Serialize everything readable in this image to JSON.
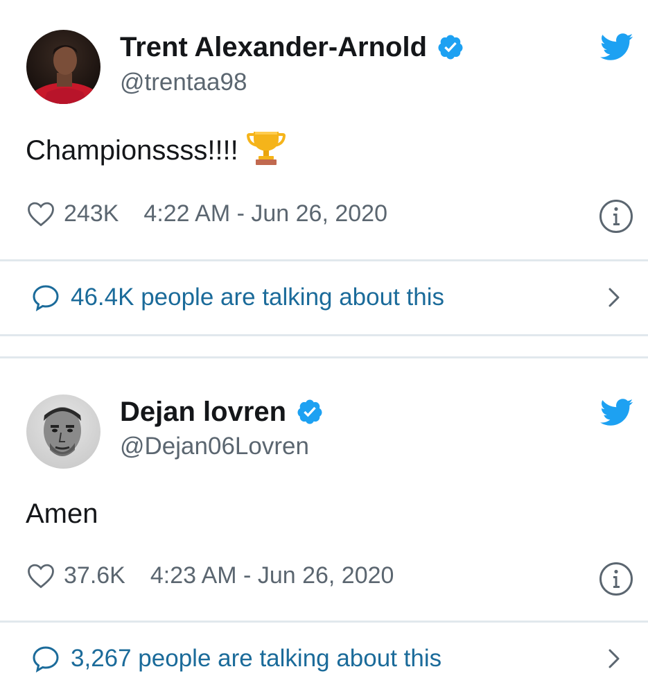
{
  "tweets": [
    {
      "author": {
        "name": "Trent Alexander-Arnold",
        "handle": "@trentaa98",
        "verified": true,
        "avatar_icon": "avatar-photo"
      },
      "text": "Championssss!!!!",
      "emoji": "trophy",
      "likes": "243K",
      "timestamp": "4:22 AM - Jun 26, 2020",
      "talking": "46.4K people are talking about this"
    },
    {
      "author": {
        "name": "Dejan lovren",
        "handle": "@Dejan06Lovren",
        "verified": true,
        "avatar_icon": "avatar-photo"
      },
      "text": "Amen",
      "likes": "37.6K",
      "timestamp": "4:23 AM - Jun 26, 2020",
      "talking": "3,267 people are talking about this"
    }
  ],
  "colors": {
    "verified_blue": "#1da1f2",
    "twitter_blue": "#1da1f2",
    "link_blue": "#1b6b9a",
    "muted_text": "#5b6670",
    "divider": "#e1e8ed"
  }
}
